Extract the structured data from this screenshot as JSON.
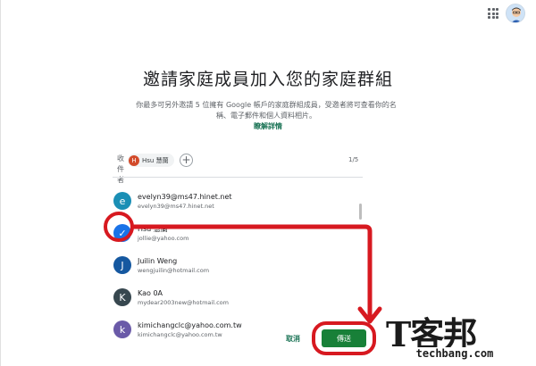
{
  "title": "邀請家庭成員加入您的家庭群組",
  "description": "你最多可另外邀請 5 位擁有 Google 帳戶的家庭群組成員，受邀者將可查看你的名稱、電子郵件和個人資料相片。",
  "learn_more": "瞭解詳情",
  "recipients": {
    "label": "收件者",
    "chip_initial": "H",
    "chip_name": "Hsu 慧蘭",
    "add": "+",
    "count": "1/5"
  },
  "contacts": [
    {
      "initial": "e",
      "name": "evelyn39@ms47.hinet.net",
      "email": "evelyn39@ms47.hinet.net",
      "color": "#1a8fb5",
      "selected": false
    },
    {
      "initial": "✓",
      "name": "Hsu 慧蘭",
      "email": "jollie@yahoo.com",
      "color": "#1a73e8",
      "selected": true
    },
    {
      "initial": "J",
      "name": "Juilin Weng",
      "email": "wengjuilin@hotmail.com",
      "color": "#1558a0",
      "selected": false
    },
    {
      "initial": "K",
      "name": "Kao 0A",
      "email": "mydear2003new@hotmail.com",
      "color": "#37474f",
      "selected": false
    },
    {
      "initial": "k",
      "name": "kimichangclc@yahoo.com.tw",
      "email": "kimichangclc@yahoo.com.tw",
      "color": "#6a5aa8",
      "selected": false
    }
  ],
  "cancel": "取消",
  "send": "傳送",
  "watermark": {
    "big": "T客邦",
    "small": "techbang.com"
  },
  "colors": {
    "accent": "#188038",
    "highlight": "#d71920"
  }
}
